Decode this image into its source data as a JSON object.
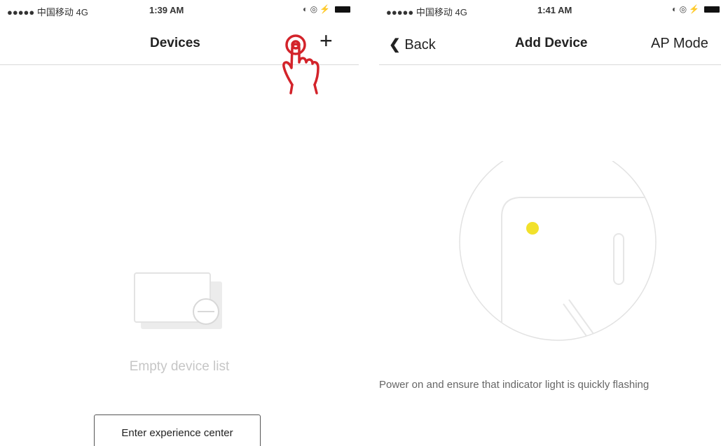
{
  "left_screen": {
    "status": {
      "carrier": "●●●●● 中国移动 4G",
      "time": "1:39 AM",
      "icons": "◐ ◎ ⚡"
    },
    "nav": {
      "title": "Devices",
      "add_symbol": "+"
    },
    "empty_text": "Empty device list",
    "experience_button": "Enter experience center"
  },
  "right_screen": {
    "status": {
      "carrier": "●●●●● 中国移动 4G",
      "time": "1:41 AM",
      "icons": "◐ ◎ ⚡"
    },
    "nav": {
      "back_label": "Back",
      "title": "Add Device",
      "right_label": "AP Mode"
    },
    "instruction": "Power on and ensure that indicator light is quickly flashing"
  },
  "colors": {
    "hand_pointer": "#d3232a",
    "indicator_light": "#f2e12b",
    "empty_text": "#c6c6c6"
  }
}
